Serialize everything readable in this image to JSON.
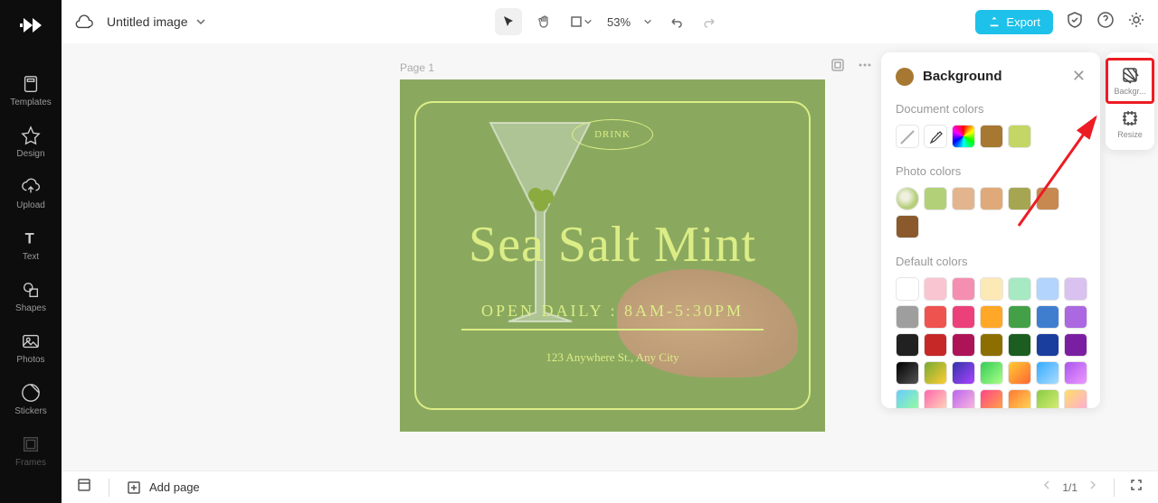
{
  "header": {
    "title": "Untitled image",
    "zoom": "53%",
    "export_label": "Export"
  },
  "left_sidebar": {
    "items": [
      {
        "label": "Templates",
        "icon": "templates-icon"
      },
      {
        "label": "Design",
        "icon": "design-icon"
      },
      {
        "label": "Upload",
        "icon": "upload-icon"
      },
      {
        "label": "Text",
        "icon": "text-icon"
      },
      {
        "label": "Shapes",
        "icon": "shapes-icon"
      },
      {
        "label": "Photos",
        "icon": "photos-icon"
      },
      {
        "label": "Stickers",
        "icon": "stickers-icon"
      },
      {
        "label": "Frames",
        "icon": "frames-icon"
      }
    ]
  },
  "canvas": {
    "page_label": "Page 1",
    "drink_badge": "DRINK",
    "title": "Sea Salt Mint",
    "subtitle": "OPEN DAILY : 8AM-5:30PM",
    "address": "123 Anywhere St., Any City",
    "bg_color": "#8aa95f",
    "accent_color": "#dced86"
  },
  "bg_panel": {
    "title": "Background",
    "sections": {
      "document": "Document colors",
      "photo": "Photo colors",
      "default": "Default colors"
    },
    "document_colors": [
      "#a67831",
      "#c4d665"
    ],
    "photo_colors": [
      "#b6cf7a",
      "#b2d078",
      "#e2b58f",
      "#dfa979",
      "#a6a652",
      "#c7894f",
      "#8a5a2d"
    ],
    "default_colors": [
      "#ffffff",
      "#f9c5d1",
      "#f48fb1",
      "#fce9b6",
      "#a6e9c3",
      "#b3d4fc",
      "#d9c1f0",
      "#9e9e9e",
      "#ef5350",
      "#ec407a",
      "#ffa726",
      "#43a047",
      "#3f7ecf",
      "#ab68e0",
      "#212121",
      "#c62828",
      "#ad1457",
      "#8d6e00",
      "#1b5e20",
      "#1a3e9e",
      "#7b1fa2",
      "#000000",
      "#8b5500",
      "#3e2d8f",
      "#6dd06d",
      "#f7b733",
      "#3ab0e8",
      "#c37de8",
      "#6dcf9f",
      "#f06292",
      "#ba68c8",
      "#ec407a",
      "#ff7043",
      "#8bc34a",
      "#f4d06f"
    ]
  },
  "right_sidebar": {
    "items": [
      {
        "label": "Backgr...",
        "icon": "background-icon"
      },
      {
        "label": "Resize",
        "icon": "resize-icon"
      }
    ]
  },
  "bottom_bar": {
    "add_page": "Add page",
    "page_indicator": "1/1"
  }
}
